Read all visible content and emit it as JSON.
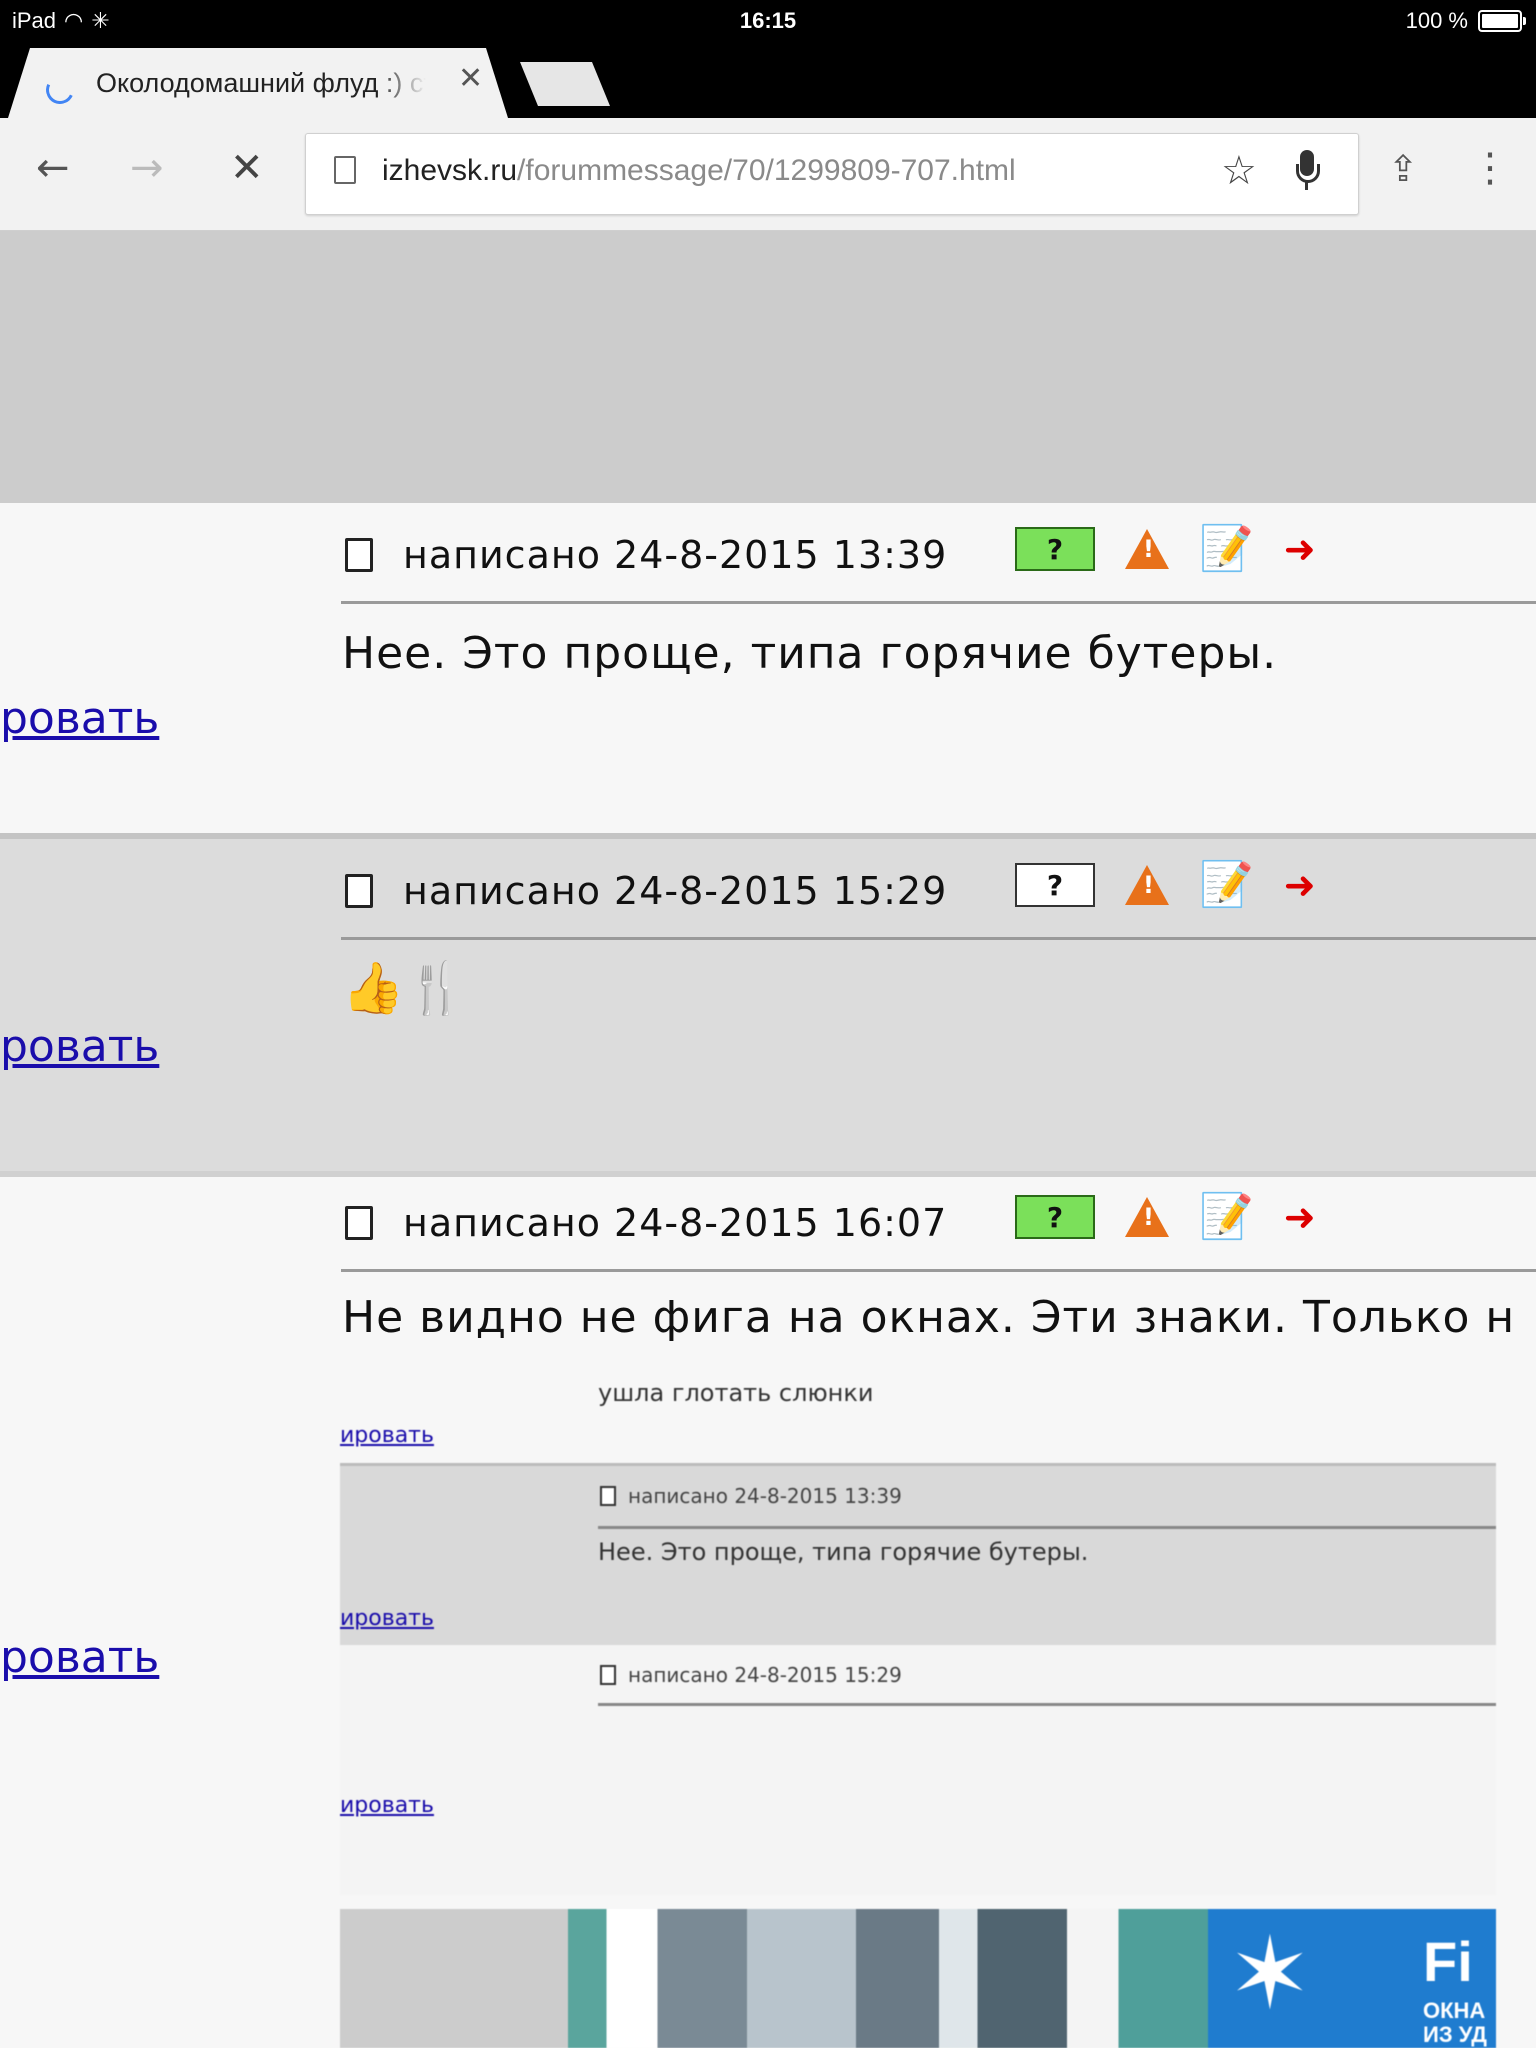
{
  "status_bar": {
    "device": "iPad",
    "time": "16:15",
    "battery": "100 %"
  },
  "browser": {
    "tab_title": "Околодомашний флуд :) ст",
    "url_host": "izhevsk.ru",
    "url_path": "/forummessage/70/1299809-707.html"
  },
  "posts": [
    {
      "date": "написано 24-8-2015 13:39",
      "text": "Нее. Это проще, типа горячие бутеры.",
      "side_link": "ровать",
      "rate_icon": "green-rate-icon"
    },
    {
      "date": "написано 24-8-2015 15:29",
      "text": "👍🍴",
      "side_link": "ровать",
      "rate_icon": "gray-rate-icon"
    },
    {
      "date": "написано 24-8-2015 16:07",
      "text": "Не видно не фига на окнах. Эти знаки. Только н",
      "side_link": "ровать",
      "rate_icon": "green-rate-icon"
    }
  ],
  "embedded_screenshot": {
    "line_top": "ушла глотать слюнки",
    "link": "ировать",
    "post1_date": "написано 24-8-2015 13:39",
    "post1_text": "Нее. Это проще, типа горячие бутеры.",
    "post2_date": "написано 24-8-2015 15:29",
    "ad_title": "Fi",
    "ad_sub": "ОКНА ИЗ УД"
  },
  "colors": {
    "link": "#1a0dab",
    "banner_gray": "#cccccc",
    "alt_row": "#dcdcdc",
    "rate_green": "#7be05a",
    "warn_orange": "#e8711a"
  }
}
